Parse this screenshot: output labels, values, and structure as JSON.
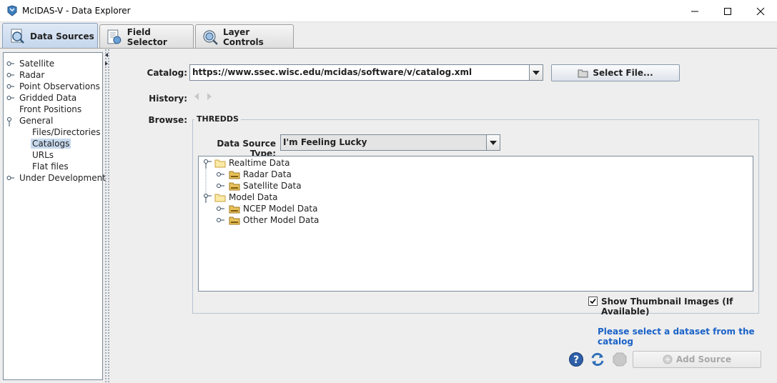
{
  "window": {
    "title": "McIDAS-V - Data Explorer"
  },
  "tabs": [
    {
      "label": "Data Sources",
      "icon": "data-sources-icon",
      "active": true
    },
    {
      "label": "Field Selector",
      "icon": "field-selector-icon",
      "active": false
    },
    {
      "label": "Layer Controls",
      "icon": "layer-controls-icon",
      "active": false
    }
  ],
  "sidebar": {
    "items": [
      {
        "label": "Satellite",
        "expandable": true
      },
      {
        "label": "Radar",
        "expandable": true
      },
      {
        "label": "Point Observations",
        "expandable": true
      },
      {
        "label": "Gridded Data",
        "expandable": true
      },
      {
        "label": "Front Positions",
        "expandable": false
      },
      {
        "label": "General",
        "expandable": true,
        "expanded": true
      },
      {
        "label": "Files/Directories",
        "child": true
      },
      {
        "label": "Catalogs",
        "child": true,
        "selected": true
      },
      {
        "label": "URLs",
        "child": true
      },
      {
        "label": "Flat files",
        "child": true
      },
      {
        "label": "Under Development",
        "expandable": true
      }
    ]
  },
  "catalog": {
    "label": "Catalog:",
    "value": "https://www.ssec.wisc.edu/mcidas/software/v/catalog.xml",
    "select_file_label": "Select File..."
  },
  "history": {
    "label": "History:"
  },
  "browse": {
    "label": "Browse:",
    "group_title": "THREDDS",
    "data_source_type_label": "Data Source Type:",
    "data_source_type_value": "I'm Feeling Lucky",
    "tree": [
      {
        "label": "Realtime Data",
        "level": 0,
        "expanded": true
      },
      {
        "label": "Radar Data",
        "level": 1
      },
      {
        "label": "Satellite Data",
        "level": 1
      },
      {
        "label": "Model Data",
        "level": 0,
        "expanded": true
      },
      {
        "label": "NCEP Model Data",
        "level": 1
      },
      {
        "label": "Other Model Data",
        "level": 1
      }
    ],
    "show_thumbnails_label": "Show Thumbnail Images (If Available)",
    "show_thumbnails_checked": true
  },
  "status_message": "Please select a dataset from the catalog",
  "footer": {
    "add_source_label": "Add Source"
  },
  "colors": {
    "status_link": "#1a62c8",
    "selection": "#c7d9ee",
    "folder": "#e8c15a"
  }
}
